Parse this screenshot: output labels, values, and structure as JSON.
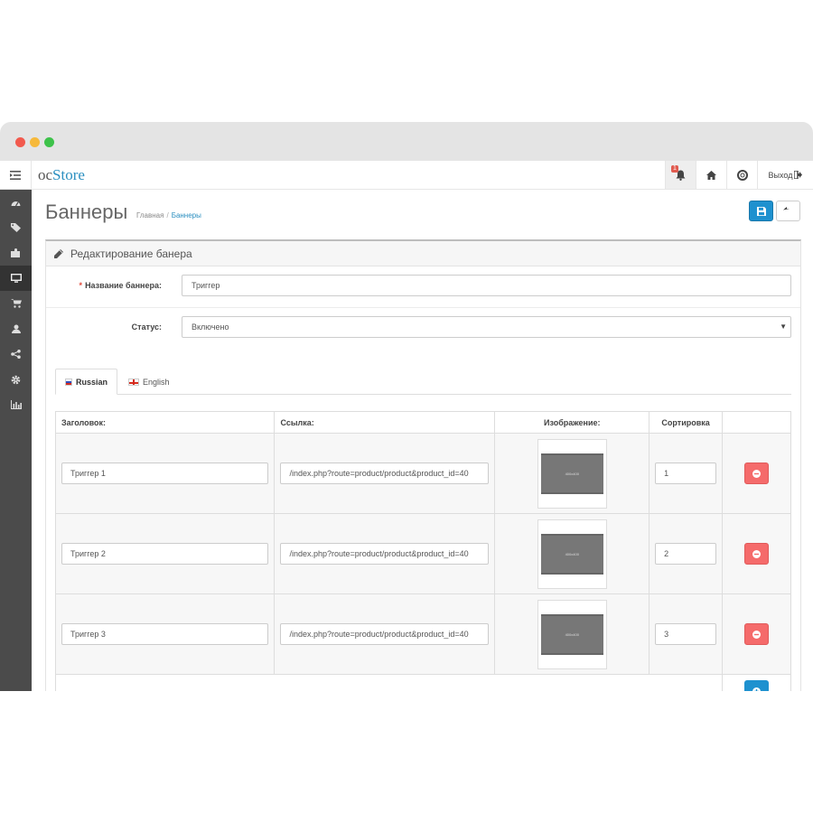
{
  "app": {
    "logo_prefix": "oc",
    "logo_brand": "Store"
  },
  "topbar": {
    "notification_count": "1",
    "logout_label": "Выход"
  },
  "page": {
    "title": "Баннеры"
  },
  "breadcrumb": {
    "home": "Главная",
    "sep": "/",
    "current": "Баннеры"
  },
  "panel": {
    "heading": "Редактирование банера"
  },
  "form": {
    "name_label": "Название баннера:",
    "name_value": "Триггер",
    "status_label": "Статус:",
    "status_value": "Включено"
  },
  "tabs": [
    {
      "label": "Russian"
    },
    {
      "label": "English"
    }
  ],
  "table": {
    "headers": {
      "title": "Заголовок:",
      "link": "Ссылка:",
      "image": "Изображение:",
      "sort": "Сортировка"
    },
    "rows": [
      {
        "title": "Триггер 1",
        "link": "/index.php?route=product/product&product_id=40",
        "image_text": "400x400",
        "sort": "1"
      },
      {
        "title": "Триггер 2",
        "link": "/index.php?route=product/product&product_id=40",
        "image_text": "400x400",
        "sort": "2"
      },
      {
        "title": "Триггер 3",
        "link": "/index.php?route=product/product&product_id=40",
        "image_text": "400x400",
        "sort": "3"
      }
    ]
  },
  "colors": {
    "primary": "#1e91cf",
    "danger": "#f56b6b",
    "sidebar": "#4b4b4b"
  }
}
